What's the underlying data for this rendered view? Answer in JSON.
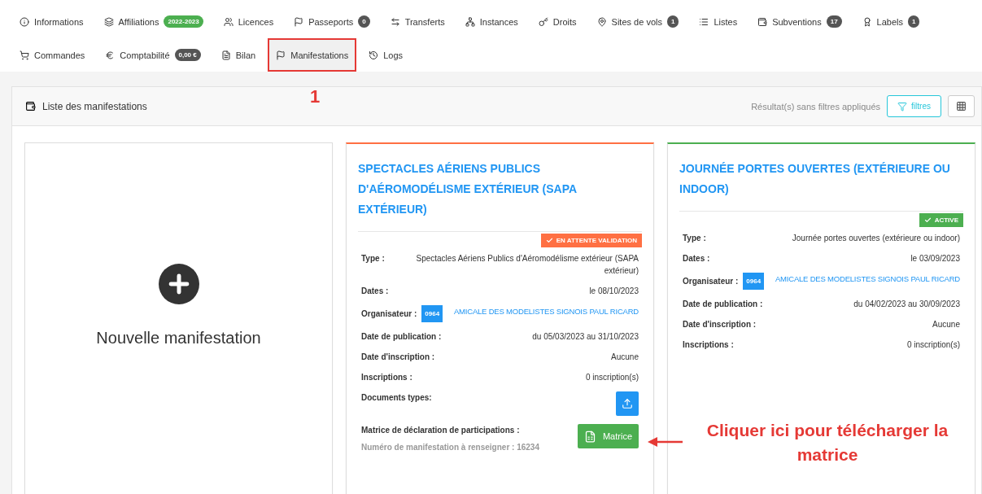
{
  "nav_rows": [
    [
      {
        "label": "Informations",
        "selected": false,
        "highlighted": false
      },
      {
        "label": "Affiliations",
        "badge": {
          "text": "2022-2023",
          "color": "#4caf50"
        },
        "selected": false,
        "highlighted": false
      },
      {
        "label": "Licences",
        "selected": false,
        "highlighted": false
      },
      {
        "label": "Passeports",
        "badge": {
          "text": "0",
          "color": "#555555"
        },
        "selected": false,
        "highlighted": false
      },
      {
        "label": "Transferts",
        "selected": false,
        "highlighted": false
      },
      {
        "label": "Instances",
        "selected": false,
        "highlighted": false
      },
      {
        "label": "Droits",
        "selected": false,
        "highlighted": false
      },
      {
        "label": "Sites de vols",
        "badge": {
          "text": "1",
          "color": "#555555"
        },
        "selected": false,
        "highlighted": false
      },
      {
        "label": "Listes",
        "selected": false,
        "highlighted": false
      },
      {
        "label": "Subventions",
        "badge": {
          "text": "17",
          "color": "#555555"
        },
        "selected": false,
        "highlighted": false
      },
      {
        "label": "Labels",
        "badge": {
          "text": "1",
          "color": "#555555"
        },
        "selected": false,
        "highlighted": false
      }
    ],
    [
      {
        "label": "Commandes",
        "selected": false,
        "highlighted": false
      },
      {
        "label": "Comptabilité",
        "badge": {
          "text": "0,00 €",
          "color": "#555555"
        },
        "selected": false,
        "highlighted": false
      },
      {
        "label": "Bilan",
        "selected": false,
        "highlighted": false
      },
      {
        "label": "Manifestations",
        "selected": true,
        "highlighted": true
      },
      {
        "label": "Logs",
        "selected": false,
        "highlighted": false
      }
    ]
  ],
  "panel": {
    "title": "Liste des manifestations",
    "result_text": "Résultat(s) sans filtres appliqués",
    "filter_button": "filtres"
  },
  "cards": [
    {
      "kind": "add",
      "label": "Nouvelle manifestation"
    },
    {
      "kind": "event",
      "title": "SPECTACLES AÉRIENS PUBLICS D'AÉROMODÉLISME EXTÉRIEUR (SAPA EXTÉRIEUR)",
      "status": {
        "label": "EN ATTENTE VALIDATION",
        "color": "#ff7043"
      },
      "rows": [
        {
          "kind": "text",
          "label": "Type :",
          "value": "Spectacles Aériens Publics d'Aéromodélisme extérieur (SAPA extérieur)"
        },
        {
          "kind": "text",
          "label": "Dates :",
          "value": "le 08/10/2023"
        },
        {
          "kind": "organizer",
          "label": "Organisateur :",
          "code": "0964",
          "value": "AMICALE DES MODELISTES SIGNOIS PAUL RICARD"
        },
        {
          "kind": "text",
          "label": "Date de publication :",
          "value": "du 05/03/2023 au 31/10/2023"
        },
        {
          "kind": "text",
          "label": "Date d'inscription :",
          "value": "Aucune"
        },
        {
          "kind": "text",
          "label": "Inscriptions :",
          "value": "0 inscription(s)"
        },
        {
          "kind": "upload",
          "label": "Documents types:"
        },
        {
          "kind": "matrix",
          "label": "Matrice de déclaration de participations :",
          "note": "Numéro de manifestation à renseigner : 16234",
          "button": "Matrice"
        }
      ]
    },
    {
      "kind": "event",
      "title": "JOURNÉE PORTES OUVERTES (EXTÉRIEURE OU INDOOR)",
      "status": {
        "label": "ACTIVE",
        "color": "#4caf50"
      },
      "rows": [
        {
          "kind": "text",
          "label": "Type :",
          "value": "Journée portes ouvertes (extérieure ou indoor)"
        },
        {
          "kind": "text",
          "label": "Dates :",
          "value": "le 03/09/2023"
        },
        {
          "kind": "organizer",
          "label": "Organisateur :",
          "code": "0964",
          "value": "AMICALE DES MODELISTES SIGNOIS PAUL RICARD"
        },
        {
          "kind": "text",
          "label": "Date de publication :",
          "value": "du 04/02/2023 au 30/09/2023"
        },
        {
          "kind": "text",
          "label": "Date d'inscription :",
          "value": "Aucune"
        },
        {
          "kind": "text",
          "label": "Inscriptions :",
          "value": "0 inscription(s)"
        }
      ]
    }
  ],
  "annotations": {
    "step_number": "1",
    "callout": "Cliquer ici pour télécharger la matrice"
  }
}
